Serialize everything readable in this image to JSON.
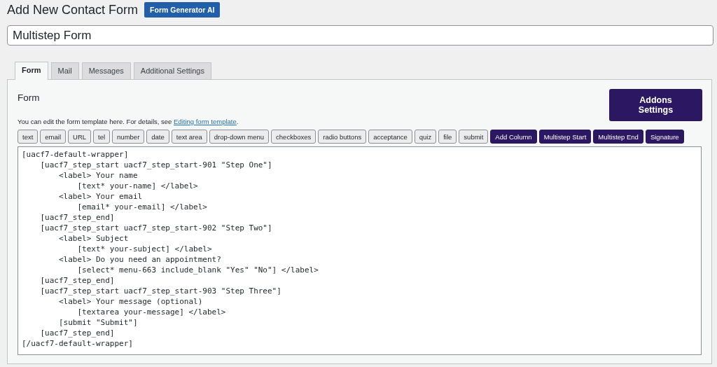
{
  "page_title": "Add New Contact Form",
  "ai_button": "Form Generator AI",
  "form_title": {
    "value": "Multistep Form"
  },
  "tabs": [
    {
      "label": "Form",
      "selected": true
    },
    {
      "label": "Mail",
      "selected": false
    },
    {
      "label": "Messages",
      "selected": false
    },
    {
      "label": "Additional Settings",
      "selected": false
    }
  ],
  "panel": {
    "heading": "Form",
    "addons_button": "Addons Settings",
    "description": "You can edit the form template here. For details, see ",
    "description_link": "Editing form template",
    "description_end": "."
  },
  "tag_buttons": [
    {
      "label": "text",
      "kind": "tag"
    },
    {
      "label": "email",
      "kind": "tag"
    },
    {
      "label": "URL",
      "kind": "tag"
    },
    {
      "label": "tel",
      "kind": "tag"
    },
    {
      "label": "number",
      "kind": "tag"
    },
    {
      "label": "date",
      "kind": "tag"
    },
    {
      "label": "text area",
      "kind": "tag"
    },
    {
      "label": "drop-down menu",
      "kind": "tag"
    },
    {
      "label": "checkboxes",
      "kind": "tag"
    },
    {
      "label": "radio buttons",
      "kind": "tag"
    },
    {
      "label": "acceptance",
      "kind": "tag"
    },
    {
      "label": "quiz",
      "kind": "tag"
    },
    {
      "label": "file",
      "kind": "tag"
    },
    {
      "label": "submit",
      "kind": "tag"
    },
    {
      "label": "Add Column",
      "kind": "addon"
    },
    {
      "label": "Multistep Start",
      "kind": "addon"
    },
    {
      "label": "Multistep End",
      "kind": "addon"
    },
    {
      "label": "Signature",
      "kind": "addon"
    }
  ],
  "template_lines": [
    "[uacf7-default-wrapper]",
    "    [uacf7_step_start uacf7_step_start-901 \"Step One\"]",
    "        <label> Your name",
    "            [text* your-name] </label>",
    "        <label> Your email",
    "            [email* your-email] </label>",
    "    [uacf7_step_end]",
    "    [uacf7_step_start uacf7_step_start-902 \"Step Two\"]",
    "        <label> Subject",
    "            [text* your-subject] </label>",
    "        <label> Do you need an appointment?",
    "            [select* menu-663 include_blank \"Yes\" \"No\"] </label>",
    "    [uacf7_step_end]",
    "    [uacf7_step_start uacf7_step_start-903 \"Step Three\"]",
    "        <label> Your message (optional)",
    "            [textarea your-message] </label>",
    "        [submit \"Submit\"]",
    "    [uacf7_step_end]",
    "[/uacf7-default-wrapper]"
  ]
}
